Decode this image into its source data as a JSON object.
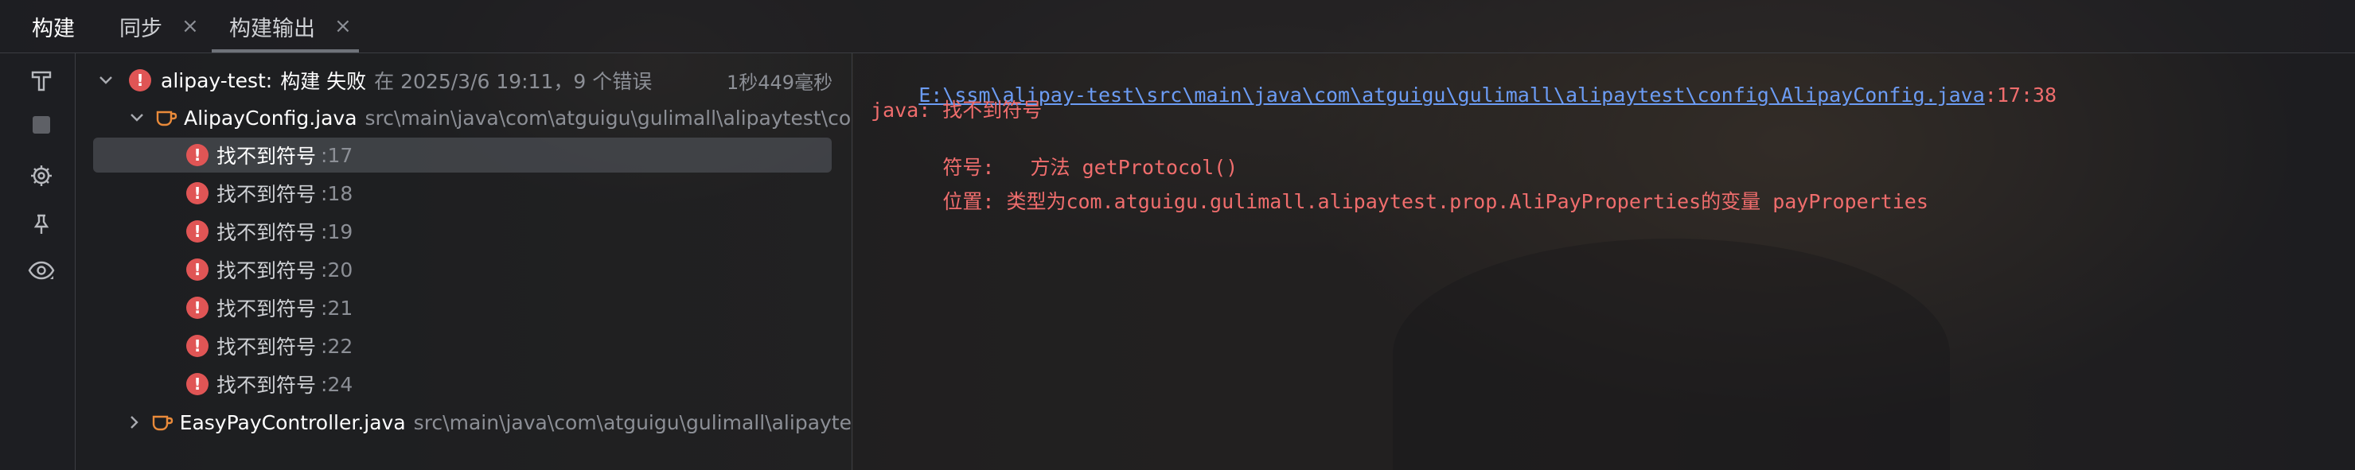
{
  "tabs": [
    {
      "label": "构建",
      "closable": false,
      "active": true
    },
    {
      "label": "同步",
      "closable": true,
      "active": false
    },
    {
      "label": "构建输出",
      "closable": true,
      "active": false
    }
  ],
  "close_glyph": "×",
  "sidebar_icons": [
    "build-hammer-icon",
    "stop-icon",
    "settings-gear-icon",
    "pin-icon",
    "eye-icon"
  ],
  "tree": {
    "root": {
      "project": "alipay-test:",
      "status": "构建 失败",
      "detail": "在 2025/3/6 19:11，9 个错误",
      "duration": "1秒449毫秒"
    },
    "files": [
      {
        "name": "AlipayConfig.java",
        "path": "src\\main\\java\\com\\atguigu\\gulimall\\alipaytest\\con",
        "expanded": true,
        "errors": [
          {
            "message": "找不到符号",
            "line": ":17"
          },
          {
            "message": "找不到符号",
            "line": ":18"
          },
          {
            "message": "找不到符号",
            "line": ":19"
          },
          {
            "message": "找不到符号",
            "line": ":20"
          },
          {
            "message": "找不到符号",
            "line": ":21"
          },
          {
            "message": "找不到符号",
            "line": ":22"
          },
          {
            "message": "找不到符号",
            "line": ":24"
          }
        ]
      },
      {
        "name": "EasyPayController.java",
        "path": "src\\main\\java\\com\\atguigu\\gulimall\\alipayte",
        "expanded": false
      }
    ]
  },
  "console": {
    "file_link": "E:\\ssm\\alipay-test\\src\\main\\java\\com\\atguigu\\gulimall\\alipaytest\\config\\AlipayConfig.java",
    "file_position": ":17:38",
    "error_line": "java: 找不到符号",
    "symbol_label": "  符号:   ",
    "symbol_value": "方法 getProtocol()",
    "location_label": "  位置: ",
    "location_value": "类型为com.atguigu.gulimall.alipaytest.prop.AliPayProperties的变量 payProperties"
  },
  "colors": {
    "error": "#e05555",
    "link": "#6c9cf4",
    "error_text": "#f06d6d"
  }
}
